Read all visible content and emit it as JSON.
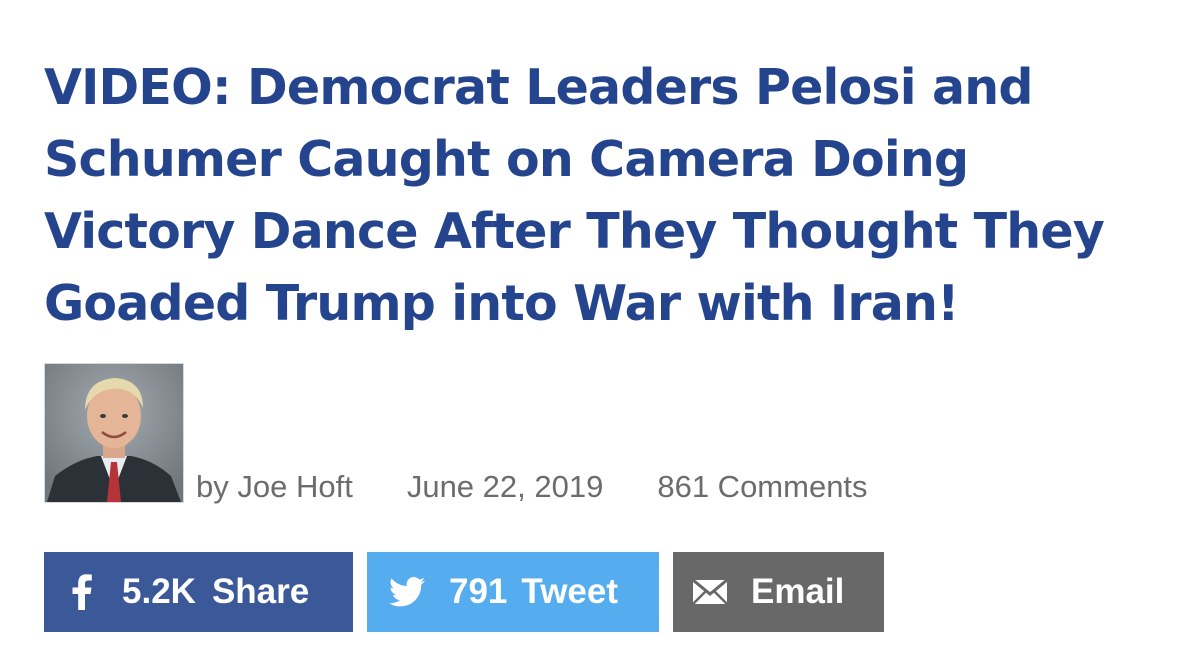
{
  "article": {
    "title": "VIDEO: Democrat Leaders Pelosi and Schumer Caught on Camera Doing Victory Dance After They Thought They Goaded Trump into War with Iran!",
    "byline": {
      "by_prefix": "by",
      "author": "Joe Hoft",
      "date": "June 22, 2019",
      "comments": "861 Comments"
    }
  },
  "share": {
    "facebook": {
      "icon": "facebook-icon",
      "count": "5.2K",
      "label": "Share",
      "color": "#3b5998"
    },
    "twitter": {
      "icon": "twitter-bird-icon",
      "count": "791",
      "label": "Tweet",
      "color": "#55acee"
    },
    "email": {
      "icon": "envelope-icon",
      "label": "Email",
      "color": "#686868"
    }
  },
  "colors": {
    "headline": "#24448e",
    "meta_text": "#6c6c6c"
  }
}
